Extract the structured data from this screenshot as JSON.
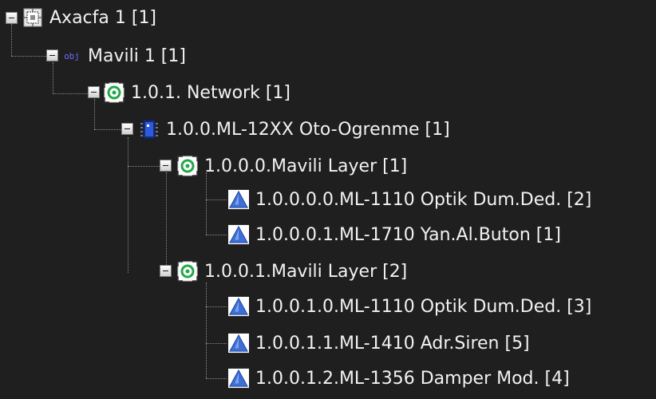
{
  "tree": {
    "root": {
      "label": "Axacfa 1 [1]",
      "icon": "grid-device-icon"
    },
    "mavili": {
      "label": "Mavili 1 [1]",
      "icon": "obj-icon",
      "icon_text": "obj"
    },
    "network": {
      "label": "1.0.1. Network [1]",
      "icon": "network-icon"
    },
    "module": {
      "label": "1.0.0.ML-12XX Oto-Ogrenme [1]",
      "icon": "chip-icon"
    },
    "layer0": {
      "label": "1.0.0.0.Mavili Layer [1]",
      "icon": "network-icon"
    },
    "layer0_items": [
      {
        "label": "1.0.0.0.0.ML-1110 Optik Dum.Ded. [2]",
        "icon": "triangle-device-icon"
      },
      {
        "label": "1.0.0.0.1.ML-1710 Yan.Al.Buton [1]",
        "icon": "triangle-device-icon"
      }
    ],
    "layer1": {
      "label": "1.0.0.1.Mavili Layer [2]",
      "icon": "network-icon"
    },
    "layer1_items": [
      {
        "label": "1.0.0.1.0.ML-1110 Optik Dum.Ded. [3]",
        "icon": "triangle-device-icon"
      },
      {
        "label": "1.0.0.1.1.ML-1410 Adr.Siren [5]",
        "icon": "triangle-device-icon"
      },
      {
        "label": "1.0.0.1.2.ML-1356 Damper Mod. [4]",
        "icon": "triangle-device-icon"
      }
    ]
  },
  "colors": {
    "background": "#1f1f1f",
    "text": "#f2f2f2",
    "connector": "#8a8a8a",
    "network_ring": "#22a84a",
    "triangle": "#3d6fd6"
  }
}
